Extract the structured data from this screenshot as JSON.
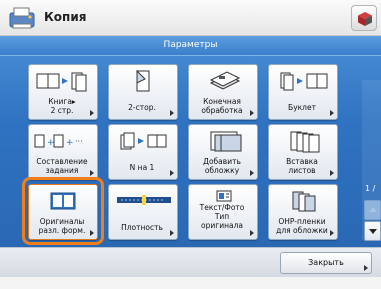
{
  "header": {
    "title": "Копия",
    "icon": "copy-machine-icon",
    "right_icon": "cube-icon"
  },
  "panel": {
    "title": "Параметры"
  },
  "tiles": [
    {
      "label": "Книга▸\n2 стр.",
      "icon": "book-to-two-pages-icon",
      "arrow": true
    },
    {
      "label": "2-стор.",
      "icon": "two-sided-icon",
      "arrow": true
    },
    {
      "label": "Конечная\nобработка",
      "icon": "finishing-icon",
      "arrow": true
    },
    {
      "label": "Буклет",
      "icon": "booklet-icon",
      "arrow": true
    },
    {
      "label": "Составление\nзадания",
      "icon": "job-build-icon",
      "arrow": true
    },
    {
      "label": "N на 1",
      "icon": "n-on-1-icon",
      "arrow": true
    },
    {
      "label": "Добавить\nобложку",
      "icon": "add-cover-icon",
      "arrow": true
    },
    {
      "label": "Вставка\nлистов",
      "icon": "insert-sheets-icon",
      "arrow": true
    },
    {
      "label": "Оригиналы\nразл. форм.",
      "icon": "different-size-originals-icon",
      "arrow": true
    },
    {
      "label": "Плотность",
      "icon": "density-slider-icon",
      "arrow": true
    },
    {
      "label": "Текст/Фото\nТип\nоригинала",
      "icon": "original-type-icon",
      "arrow": true
    },
    {
      "label": "OHP-пленки\nдля обложки",
      "icon": "ohp-film-icon",
      "arrow": true
    }
  ],
  "page_indicator": "1 / ",
  "bottom": {
    "close_label": "Закрыть"
  },
  "colors": {
    "panel_blue": "#2f73c2",
    "highlight": "#ef7f1a"
  }
}
